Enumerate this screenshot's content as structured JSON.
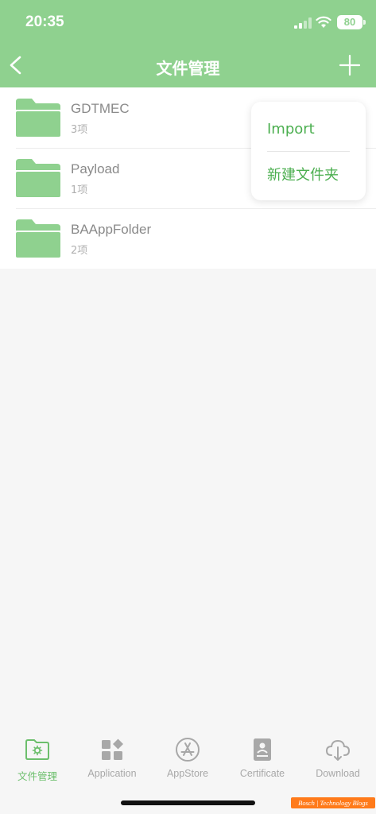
{
  "status_bar": {
    "time": "20:35",
    "battery": "80",
    "icons": [
      "signal-icon",
      "wifi-icon",
      "battery-icon"
    ]
  },
  "nav": {
    "title": "文件管理",
    "back_icon": "chevron-left-icon",
    "add_icon": "plus-icon"
  },
  "files": [
    {
      "name": "GDTMEC",
      "count": "3项",
      "icon": "folder-icon"
    },
    {
      "name": "Payload",
      "count": "1项",
      "icon": "folder-icon"
    },
    {
      "name": "BAAppFolder",
      "count": "2项",
      "icon": "folder-icon"
    }
  ],
  "popover": {
    "items": [
      "Import",
      "新建文件夹"
    ]
  },
  "tabs": [
    {
      "label": "文件管理",
      "icon": "folder-gear-icon",
      "active": true
    },
    {
      "label": "Application",
      "icon": "apps-grid-icon",
      "active": false
    },
    {
      "label": "AppStore",
      "icon": "app-store-icon",
      "active": false
    },
    {
      "label": "Certificate",
      "icon": "certificate-icon",
      "active": false
    },
    {
      "label": "Download",
      "icon": "cloud-download-icon",
      "active": false
    }
  ],
  "watermark": "Bosch | Technology Blogs",
  "colors": {
    "header": "#8fd18f",
    "folder": "#8fd18f",
    "accent_text": "#4caf50",
    "active_tab": "#6cbf6c",
    "inactive_tab": "#a8a8a8",
    "watermark_bg": "#ff7a1a"
  }
}
